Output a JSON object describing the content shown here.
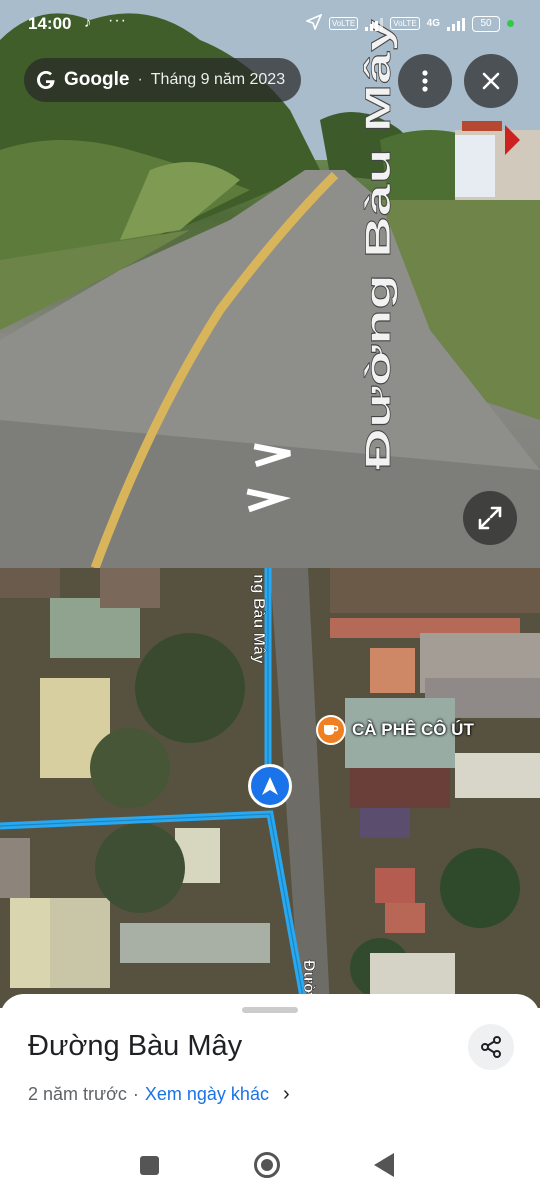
{
  "status_bar": {
    "time": "14:00",
    "notification_icons": [
      "tiktok-icon",
      "more-dots-icon"
    ],
    "network_badge_1": "VoLTE",
    "network_badge_2": "VoLTE",
    "network_type": "4G",
    "battery": "50",
    "battery_color": "#ffffff"
  },
  "street_view": {
    "brand": "Google",
    "separator": "·",
    "capture_date": "Tháng 9 năm 2023",
    "road_label": "Đường Bàu Mây",
    "buttons": [
      "more-vert-icon",
      "close-icon",
      "expand-icon"
    ]
  },
  "map": {
    "road_label_top": "ng Bàu Mây",
    "road_label_bottom": "Đườ",
    "poi_name": "CÀ PHÊ CÔ ÚT",
    "poi_icon": "coffee-icon",
    "poi_color": "#f07f22",
    "route_color": "#29a8f0",
    "location_color": "#1a73e8"
  },
  "sheet": {
    "title": "Đường Bàu Mây",
    "time_ago": "2 năm trước",
    "separator": "·",
    "other_dates_link": "Xem ngày khác",
    "share_icon": "share-icon"
  },
  "nav_bar": {
    "buttons": [
      "recents-square-icon",
      "home-circle-icon",
      "back-triangle-icon"
    ]
  }
}
